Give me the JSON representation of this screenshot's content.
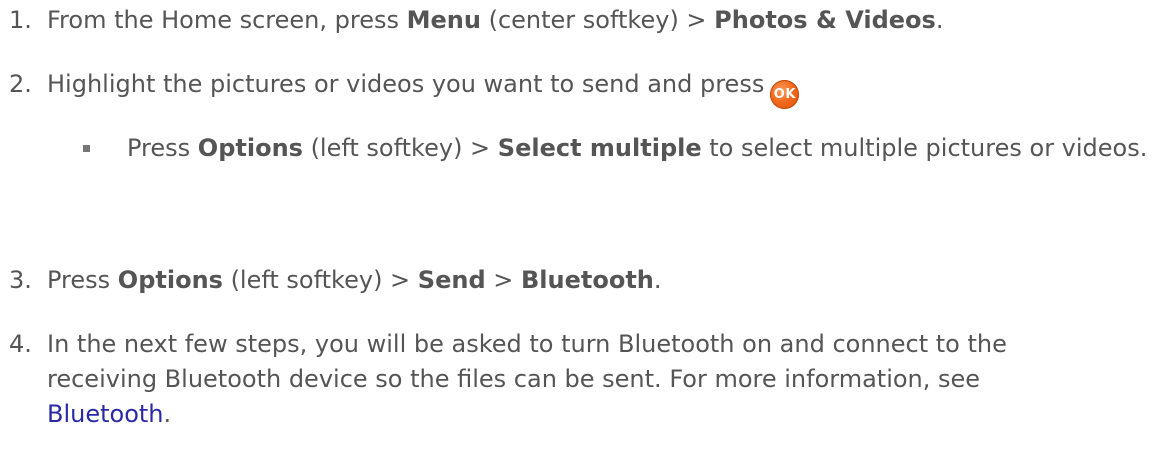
{
  "steps": [
    {
      "num": "1.",
      "parts": [
        "From the Home screen, press ",
        "Menu",
        " (center softkey) > ",
        "Photos & Videos",
        "."
      ]
    },
    {
      "num": "2.",
      "parts": [
        "Highlight the pictures or videos you want to send and press"
      ],
      "ok_label": "OK"
    },
    {
      "bullet_parts": [
        "Press ",
        "Options",
        " (left softkey) > ",
        "Select multiple",
        " to select multiple pictures or videos."
      ]
    },
    {
      "num": "3.",
      "parts": [
        "Press ",
        "Options",
        " (left softkey) > ",
        "Send",
        " > ",
        "Bluetooth",
        "."
      ]
    },
    {
      "num": "4.",
      "lines": [
        "In the next few steps, you will be asked to turn Bluetooth on and connect to the",
        "receiving Bluetooth device so the files can be sent. For more information, see"
      ],
      "link": "Bluetooth",
      "tail": "."
    }
  ]
}
